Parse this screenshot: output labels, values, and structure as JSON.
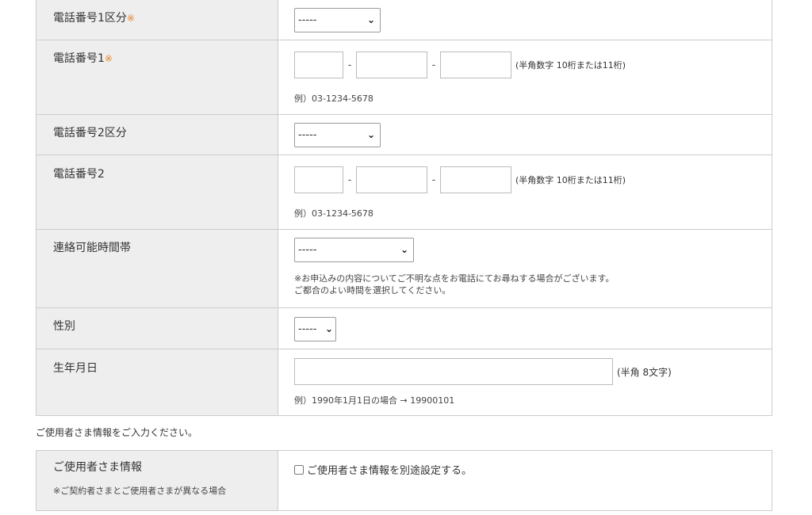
{
  "phone1_type": {
    "label": "電話番号1区分",
    "required_mark": "※",
    "select_value": "-----"
  },
  "phone1": {
    "label": "電話番号1",
    "required_mark": "※",
    "separator": "-",
    "hint": "(半角数字 10桁または11桁)",
    "example": "例）03-1234-5678"
  },
  "phone2_type": {
    "label": "電話番号2区分",
    "select_value": "-----"
  },
  "phone2": {
    "label": "電話番号2",
    "separator": "-",
    "hint": "(半角数字 10桁または11桁)",
    "example": "例）03-1234-5678"
  },
  "contact_time": {
    "label": "連絡可能時間帯",
    "select_value": "-----",
    "note_line1": "※お申込みの内容についてご不明な点をお電話にてお尋ねする場合がございます。",
    "note_line2": "ご都合のよい時間を選択してください。"
  },
  "gender": {
    "label": "性別",
    "select_value": "-----"
  },
  "birthdate": {
    "label": "生年月日",
    "hint": "(半角 8文字)",
    "example": "例）1990年1月1日の場合 → 19900101"
  },
  "user_section_caption": "ご使用者さま情報をご入力ください。",
  "user_info": {
    "label": "ご使用者さま情報",
    "sub_note": "※ご契約者さまとご使用者さまが異なる場合",
    "checkbox_label": "ご使用者さま情報を別途設定する。"
  },
  "icons": {
    "select_arrow": "chevron-down-icon",
    "checkbox": "checkbox-icon"
  },
  "colors": {
    "required": "#e8842c",
    "label_bg": "#eeeeee",
    "border": "#cccccc"
  }
}
